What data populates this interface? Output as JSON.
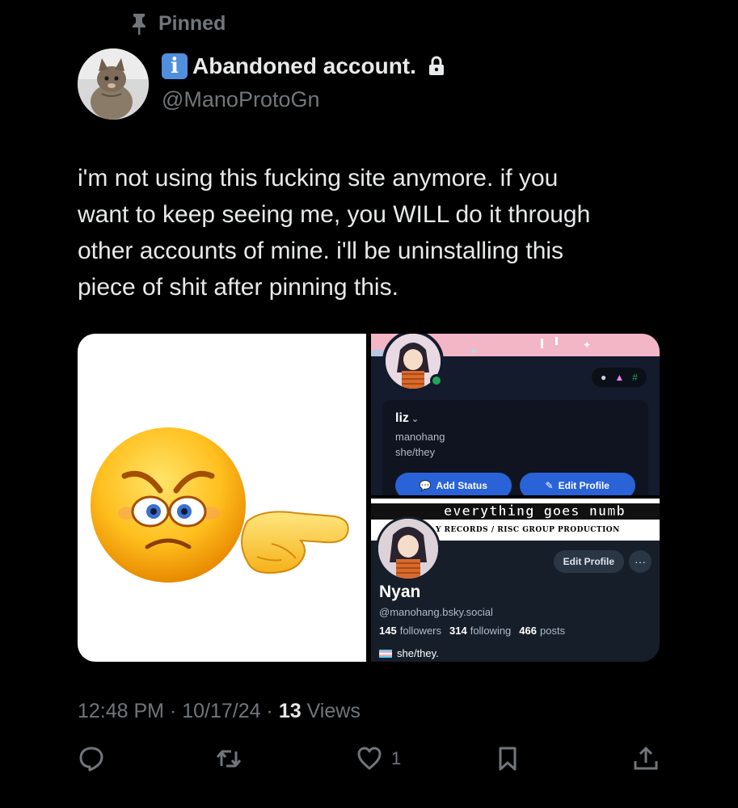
{
  "pinned": {
    "label": "Pinned",
    "icon": "pin-icon"
  },
  "author": {
    "display_name": "Abandoned account.",
    "handle": "@ManoProtoGn",
    "badge_icon": "info-icon",
    "lock_icon": "lock-icon"
  },
  "tweet": {
    "text": "i'm not using this fucking site anymore. if you\nwant to keep seeing me, you WILL do it through\nother accounts of mine. i'll be uninstalling this\npiece of shit after pinning this."
  },
  "media": {
    "discord": {
      "name": "liz",
      "username": "manohang",
      "pronouns": "she/they",
      "add_status": "Add Status",
      "edit_profile": "Edit Profile"
    },
    "bluesky": {
      "banner_title": "everything goes numb",
      "banner_subtitle": "Y RECORDS / RISC GROUP PRODUCTION",
      "edit_profile": "Edit Profile",
      "more": "···",
      "name": "Nyan",
      "handle": "@manohang.bsky.social",
      "followers_count": "145",
      "followers_label": "followers",
      "following_count": "314",
      "following_label": "following",
      "posts_count": "466",
      "posts_label": "posts",
      "pronouns": "she/they."
    }
  },
  "meta": {
    "time": "12:48 PM",
    "date": "10/17/24",
    "views_count": "13",
    "views_label": "Views"
  },
  "actions": {
    "like_count": "1"
  },
  "colors": {
    "background": "#000000",
    "text": "#e7e9ea",
    "muted": "#71767b"
  }
}
